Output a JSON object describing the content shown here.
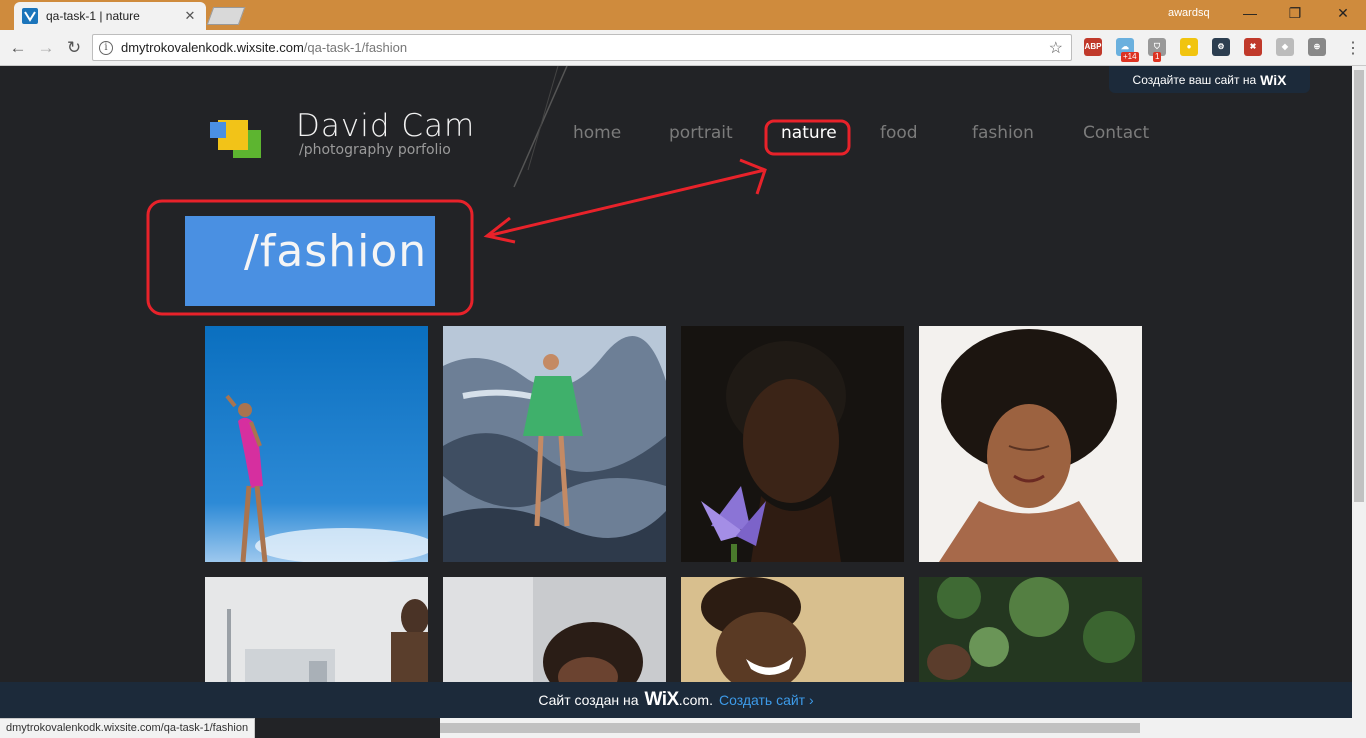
{
  "browser": {
    "tab_title": "qa-task-1 | nature",
    "tab_close": "✕",
    "profile_name": "awardsq",
    "window_controls": {
      "minimize": "—",
      "restore": "❐",
      "close": "✕"
    },
    "url_host": "dmytrokovalenkodk.wixsite.com",
    "url_path": "/qa-task-1/fashion",
    "nav_icons": {
      "back": "←",
      "forward": "→",
      "reload": "↻",
      "star": "☆",
      "menu": "⋮",
      "info": "i"
    },
    "extensions": [
      {
        "name": "abp-icon",
        "label": "ABP",
        "color": "#c0392b"
      },
      {
        "name": "cloud-icon",
        "label": "☁",
        "color": "#6ab0de",
        "badge": "+14"
      },
      {
        "name": "shield-icon",
        "label": "⛉",
        "color": "#999999",
        "badge": "1"
      },
      {
        "name": "bulb-icon",
        "label": "●",
        "color": "#f1c40f"
      },
      {
        "name": "gear-icon",
        "label": "⚙",
        "color": "#2c3e50"
      },
      {
        "name": "x-icon",
        "label": "✖",
        "color": "#c0392b"
      },
      {
        "name": "puzzle-icon",
        "label": "◆",
        "color": "#bbbbbb"
      },
      {
        "name": "plus-circle-icon",
        "label": "⊕",
        "color": "#888888"
      }
    ],
    "status_url": "dmytrokovalenkodk.wixsite.com/qa-task-1/fashion"
  },
  "wix_top": {
    "text": "Создайте ваш сайт на",
    "brand": "WiX"
  },
  "site": {
    "title": "David Cam",
    "subtitle": "/photography porfolio",
    "nav": [
      "home",
      "portrait",
      "nature",
      "food",
      "fashion",
      "Contact"
    ],
    "active_nav": "nature",
    "page_heading": "/fashion"
  },
  "logo_colors": {
    "blue": "#4a90e2",
    "yellow": "#f2c318",
    "green": "#5db530"
  },
  "annotation_color": "#e8222a",
  "wix_bottom": {
    "text": "Сайт создан на",
    "brand": "WiX",
    "domain": ".com.",
    "link": "Создать сайт ›"
  }
}
